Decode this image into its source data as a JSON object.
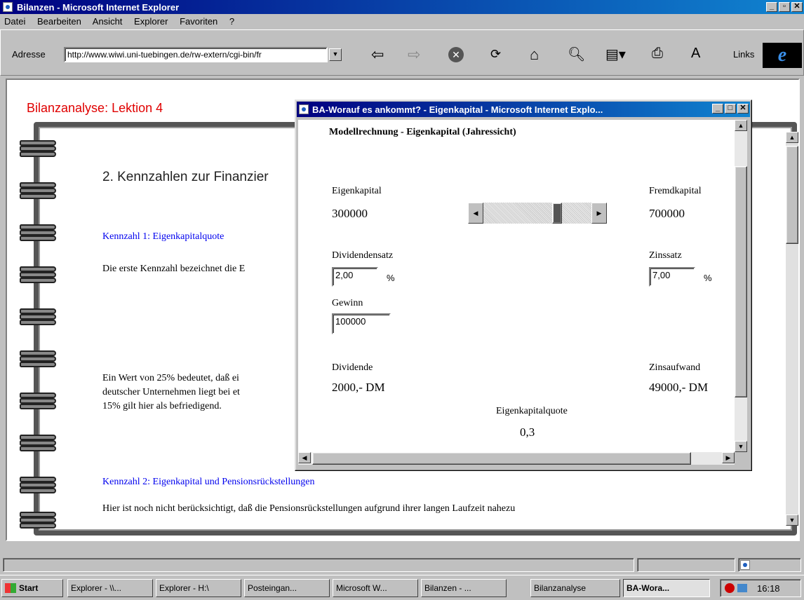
{
  "main_window": {
    "title": "Bilanzen - Microsoft Internet Explorer",
    "menu": [
      "Datei",
      "Bearbeiten",
      "Ansicht",
      "Explorer",
      "Favoriten",
      "?"
    ],
    "address_label": "Adresse",
    "address_value": "http://www.wiwi.uni-tuebingen.de/rw-extern/cgi-bin/fr",
    "links_label": "Links"
  },
  "page": {
    "lesson_title": "Bilanzanalyse: Lektion 4",
    "section_heading": "2. Kennzahlen zur Finanzier",
    "kennzahl1_link": "Kennzahl 1: Eigenkapitalquote",
    "para1": "Die erste Kennzahl bezeichnet die E",
    "para2_line1": "Ein Wert von 25% bedeutet, daß ei",
    "para2_line2": "deutscher Unternehmen liegt bei et",
    "para2_line3": "15% gilt hier als befriedigend.",
    "kennzahl2_link": "Kennzahl 2: Eigenkapital und Pensionsrückstellungen",
    "para3": "Hier ist noch nicht berücksichtigt, daß die Pensionsrückstellungen aufgrund ihrer langen Laufzeit nahezu"
  },
  "popup": {
    "title": "BA-Worauf es ankommt? - Eigenkapital - Microsoft Internet Explo...",
    "heading": "Modellrechnung - Eigenkapital (Jahressicht)",
    "eigenkapital_label": "Eigenkapital",
    "eigenkapital_value": "300000",
    "fremdkapital_label": "Fremdkapital",
    "fremdkapital_value": "700000",
    "slider_value": 0.3,
    "dividendensatz_label": "Dividendensatz",
    "dividendensatz_value": "2,00",
    "percent": "%",
    "zinssatz_label": "Zinssatz",
    "zinssatz_value": "7,00",
    "gewinn_label": "Gewinn",
    "gewinn_value": "100000",
    "dividende_label": "Dividende",
    "dividende_value": "2000,- DM",
    "zinsaufwand_label": "Zinsaufwand",
    "zinsaufwand_value": "49000,- DM",
    "quote_label": "Eigenkapitalquote",
    "quote_value": "0,3"
  },
  "taskbar": {
    "start": "Start",
    "items": [
      "Explorer - \\\\...",
      "Explorer - H:\\",
      "Posteingan...",
      "Microsoft W...",
      "Bilanzen - ...",
      "Bilanzanalyse",
      "BA-Wora..."
    ],
    "clock": "16:18"
  }
}
